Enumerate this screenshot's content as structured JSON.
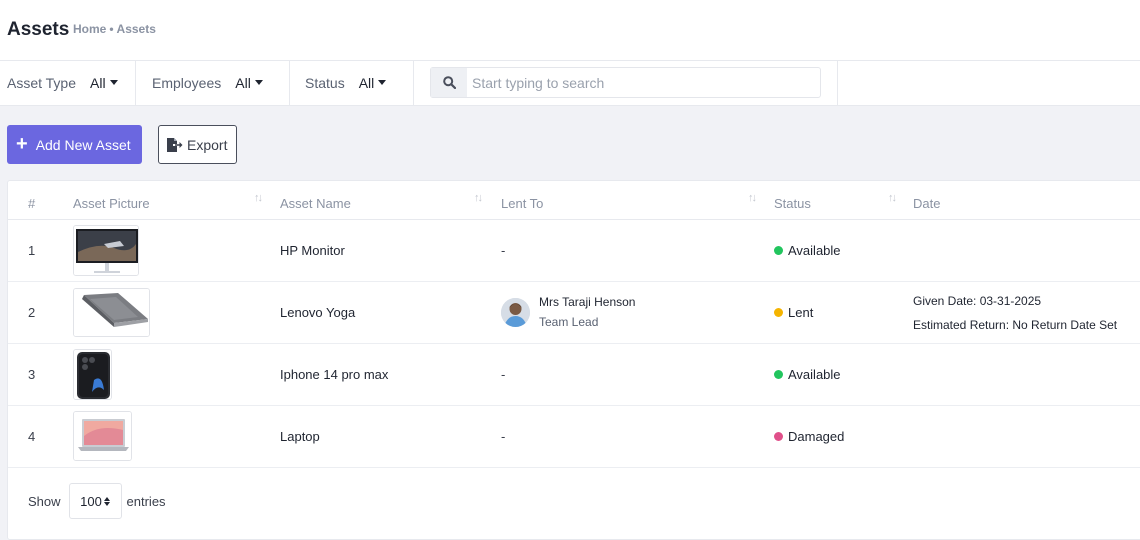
{
  "header": {
    "title": "Assets",
    "breadcrumb": {
      "home": "Home",
      "separator": "•",
      "current": "Assets"
    }
  },
  "filters": {
    "asset_type": {
      "label": "Asset Type",
      "value": "All"
    },
    "employees": {
      "label": "Employees",
      "value": "All"
    },
    "status": {
      "label": "Status",
      "value": "All"
    },
    "search": {
      "placeholder": "Start typing to search",
      "value": ""
    }
  },
  "actions": {
    "add_label": "Add New Asset",
    "add_icon": "plus-icon",
    "export_label": "Export",
    "export_icon": "file-export-icon",
    "accent_color": "#6b67e0"
  },
  "table": {
    "columns": {
      "num": "#",
      "picture": "Asset Picture",
      "name": "Asset Name",
      "lent_to": "Lent To",
      "status": "Status",
      "date": "Date"
    },
    "rows": [
      {
        "num": "1",
        "picture": "monitor-image",
        "name": "HP Monitor",
        "lent_to": "-",
        "status": "Available",
        "status_color": "#22c55e"
      },
      {
        "num": "2",
        "picture": "laptop-image",
        "name": "Lenovo Yoga",
        "lent_to": "",
        "person": {
          "name": "Mrs Taraji Henson",
          "role": "Team Lead"
        },
        "status": "Lent",
        "status_color": "#f5b400",
        "given_date": "Given Date: 03-31-2025",
        "estimated_return": "Estimated Return: No Return Date Set"
      },
      {
        "num": "3",
        "picture": "phone-image",
        "name": "Iphone 14 pro max",
        "lent_to": "-",
        "status": "Available",
        "status_color": "#22c55e"
      },
      {
        "num": "4",
        "picture": "laptop-image",
        "name": "Laptop",
        "lent_to": "-",
        "status": "Damaged",
        "status_color": "#e0508a"
      }
    ]
  },
  "footer": {
    "show_label": "Show",
    "page_size": "100",
    "entries_label": "entries"
  }
}
